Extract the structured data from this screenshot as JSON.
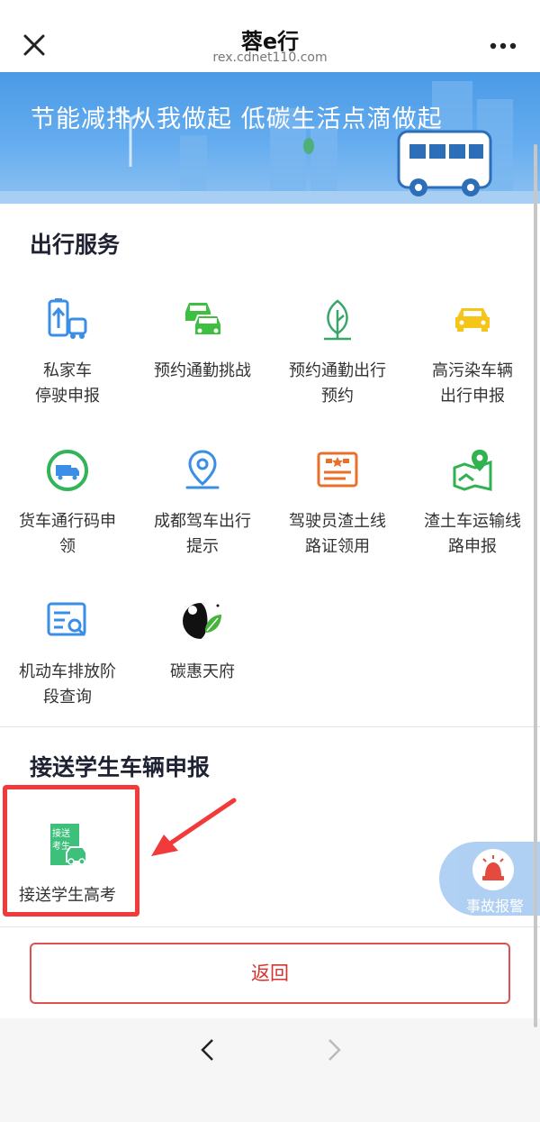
{
  "topbar": {
    "title": "蓉e行",
    "url": "rex.cdnet110.com",
    "close_icon": "close-icon",
    "more_icon": "more-icon"
  },
  "banner": {
    "slogan": "节能减排从我做起 低碳生活点滴做起"
  },
  "travel_services": {
    "title": "出行服务",
    "items": [
      {
        "label": "私家车\n停驶申报",
        "icon": "private-car-icon",
        "color": "#3a8ee6"
      },
      {
        "label": "预约通勤挑战",
        "icon": "cars-icon",
        "color": "#3fbf3f"
      },
      {
        "label": "预约通勤出行\n预约",
        "icon": "leaf-icon",
        "color": "#3aa56b"
      },
      {
        "label": "高污染车辆\n出行申报",
        "icon": "car-icon",
        "color": "#f5c518"
      },
      {
        "label": "货车通行码申\n领",
        "icon": "truck-code-icon",
        "color": "#33b35a"
      },
      {
        "label": "成都驾车出行\n提示",
        "icon": "location-icon",
        "color": "#3a8ee6"
      },
      {
        "label": "驾驶员渣土线\n路证领用",
        "icon": "license-card-icon",
        "color": "#e8702a"
      },
      {
        "label": "渣土车运输线\n路申报",
        "icon": "map-route-icon",
        "color": "#2fb24f"
      },
      {
        "label": "机动车排放阶\n段查询",
        "icon": "search-doc-icon",
        "color": "#3a8ee6"
      },
      {
        "label": "碳惠天府",
        "icon": "panda-logo-icon",
        "color": "#46b33a"
      }
    ]
  },
  "student_section": {
    "title": "接送学生车辆申报",
    "items": [
      {
        "label": "接送学生高考",
        "icon": "student-transport-icon",
        "color": "#3cc07a",
        "icon_text_1": "接送",
        "icon_text_2": "考生"
      }
    ]
  },
  "accident_button": {
    "label": "事故报警",
    "icon": "alarm-light-icon"
  },
  "back_button": {
    "label": "返回"
  },
  "bottom_nav": {
    "back_icon": "chevron-left-icon",
    "forward_icon": "chevron-right-icon"
  },
  "colors": {
    "banner": "#5aa6ec",
    "accent_red": "#f23a3a",
    "highlight": "#f23a3a"
  }
}
